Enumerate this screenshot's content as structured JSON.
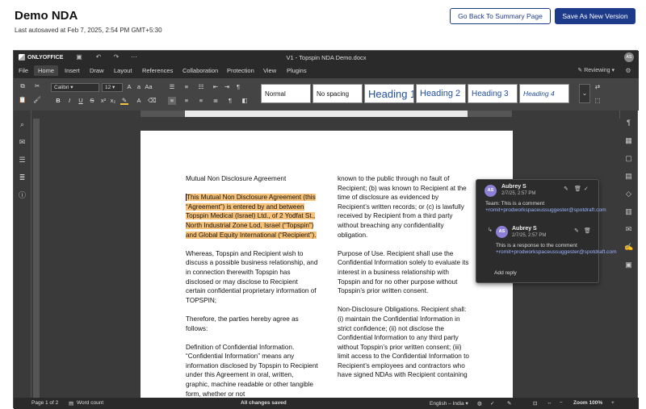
{
  "header": {
    "title": "Demo NDA",
    "autosave": "Last autosaved at Feb 7, 2025, 2:54 PM GMT+5:30",
    "back_button": "Go Back To Summary Page",
    "save_button": "Save As New Version"
  },
  "editor": {
    "app_name": "ONLYOFFICE",
    "file_title": "V1 - Topspin NDA Demo.docx",
    "user_initials": "AS",
    "menu": [
      "File",
      "Home",
      "Insert",
      "Draw",
      "Layout",
      "References",
      "Collaboration",
      "Protection",
      "View",
      "Plugins"
    ],
    "active_menu": "Home",
    "reviewing_label": "Reviewing",
    "font_name": "Calibri",
    "font_size": "12",
    "styles": [
      "Normal",
      "No spacing",
      "Heading 1",
      "Heading 2",
      "Heading 3",
      "Heading 4"
    ]
  },
  "document": {
    "left_column": {
      "title": "Mutual Non Disclosure Agreement",
      "highlighted": "This Mutual Non Disclosure Agreement (this “Agreement”) is entered by and between Topspin Medical (Israel) Ltd., of 2 Yodfat St., North Industrial Zone Lod, Israel (“Topspin”) and Global Equity International (“Recipient”).",
      "p2": "Whereas, Topspin and Recipient wish to discuss a possible business relationship, and in connection therewith Topspin has disclosed or may disclose to Recipient certain confidential proprietary information of TOPSPIN;",
      "p3": "Therefore, the parties hereby agree as follows:",
      "p4": "Definition of Confidential Information. “Confidential Information” means any information disclosed by Topspin to Recipient under this Agreement in oral, written, graphic, machine readable or other tangible form, whether or not"
    },
    "right_column": {
      "p1": "known to the public through no fault of Recipient; (b) was known to Recipient at the time of disclosure as evidenced by Recipient’s written records; or (c) is lawfully received by Recipient from a third party without breaching any confidentiality obligation.",
      "p2": "Purpose of Use. Recipient shall use the Confidential Information solely to evaluate its interest in a business relationship with Topspin and for no other purpose without Topspin’s prior written consent.",
      "p3": "Non-Disclosure Obligations. Recipient shall: (i) maintain the Confidential Information in strict confidence; (ii) not disclose the Confidential Information to any third party without Topspin’s prior written consent; (iii) limit access to the Confidential Information to Recipient’s employees and contractors who have signed NDAs with Recipient containing"
    }
  },
  "comment": {
    "author": "Aubrey S",
    "initials": "AS",
    "date": "2/7/25, 2:57 PM",
    "text_prefix": "Team: This is a comment",
    "mention": "+romit+prodworkspaceussuggester@spotdraft.com",
    "reply": {
      "author": "Aubrey S",
      "initials": "AS",
      "date": "2/7/25, 2:57 PM",
      "text_prefix": "This is a response to the comment",
      "mention": "+romit+prodworkspaceussuggester@spotdraft.com"
    },
    "add_reply": "Add reply"
  },
  "status": {
    "page": "Page 1 of 2",
    "word_count": "Word count",
    "saved": "All changes saved",
    "language": "English – India",
    "zoom": "Zoom 100%"
  },
  "colors": {
    "brand_primary": "#1e3a8a",
    "highlight": "#f6c27a",
    "avatar": "#8b7fd6",
    "heading_blue": "#1f4e9c"
  }
}
